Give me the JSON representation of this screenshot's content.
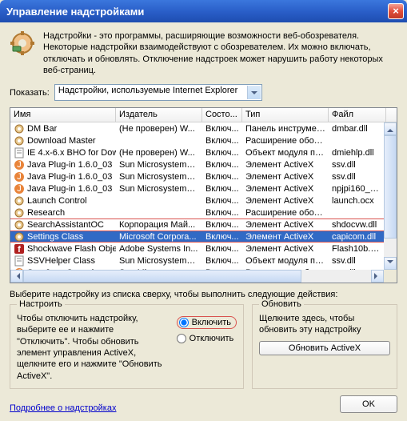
{
  "window_title": "Управление надстройками",
  "info": "Надстройки - это программы, расширяющие возможности веб-обозревателя. Некоторые надстройки взаимодействуют с обозревателем. Их можно включать, отключать и обновлять. Отключение надстроек может нарушить работу некоторых веб-страниц.",
  "show_label": "Показать:",
  "show_value": "Надстройки, используемые Internet Explorer",
  "columns": {
    "name": "Имя",
    "publisher": "Издатель",
    "state": "Состо...",
    "type": "Тип",
    "file": "Файл"
  },
  "rows": [
    {
      "icon": "gear-small",
      "name": "DM Bar",
      "publisher": "(Не проверен) W...",
      "state": "Включ...",
      "type": "Панель инструмен...",
      "file": "dmbar.dll"
    },
    {
      "icon": "gear-small",
      "name": "Download Master",
      "publisher": "",
      "state": "Включ...",
      "type": "Расширение обозр...",
      "file": ""
    },
    {
      "icon": "doc",
      "name": "IE 4.x-6.x BHO for Dow...",
      "publisher": "(Не проверен) W...",
      "state": "Включ...",
      "type": "Объект модуля по...",
      "file": "dmiehlp.dll"
    },
    {
      "icon": "java",
      "name": "Java Plug-in 1.6.0_03",
      "publisher": "Sun Microsystems,...",
      "state": "Включ...",
      "type": "Элемент ActiveX",
      "file": "ssv.dll"
    },
    {
      "icon": "java",
      "name": "Java Plug-in 1.6.0_03",
      "publisher": "Sun Microsystems,...",
      "state": "Включ...",
      "type": "Элемент ActiveX",
      "file": "ssv.dll"
    },
    {
      "icon": "java",
      "name": "Java Plug-in 1.6.0_03",
      "publisher": "Sun Microsystems,...",
      "state": "Включ...",
      "type": "Элемент ActiveX",
      "file": "npjpi160_03.dll"
    },
    {
      "icon": "gear-small",
      "name": "Launch Control",
      "publisher": "",
      "state": "Включ...",
      "type": "Элемент ActiveX",
      "file": "launch.ocx"
    },
    {
      "icon": "gear-small",
      "name": "Research",
      "publisher": "",
      "state": "Включ...",
      "type": "Расширение обозр...",
      "file": ""
    },
    {
      "icon": "gear-small",
      "name": "SearchAssistantOC",
      "publisher": "Корпорация Май...",
      "state": "Включ...",
      "type": "Элемент ActiveX",
      "file": "shdocvw.dll",
      "hl_top": true
    },
    {
      "icon": "gear-small",
      "name": "Settings Class",
      "publisher": "Microsoft Corpora...",
      "state": "Включ...",
      "type": "Элемент ActiveX",
      "file": "capicom.dll",
      "selected": true,
      "hl_bot": true
    },
    {
      "icon": "flash",
      "name": "Shockwave Flash Object",
      "publisher": "Adobe Systems In...",
      "state": "Включ...",
      "type": "Элемент ActiveX",
      "file": "Flash10b.ocx"
    },
    {
      "icon": "doc",
      "name": "SSVHelper Class",
      "publisher": "Sun Microsystems,...",
      "state": "Включ...",
      "type": "Объект модуля по...",
      "file": "ssv.dll"
    },
    {
      "icon": "java",
      "name": "Sun Java Console",
      "publisher": "Sun Microsystems,...",
      "state": "Включ...",
      "type": "Расширение обозр...",
      "file": "ssv.dll"
    }
  ],
  "instruction": "Выберите надстройку из списка сверху, чтобы выполнить следующие действия:",
  "group_settings_title": "Настроить",
  "settings_text": "Чтобы отключить надстройку, выберите ее и нажмите \"Отключить\". Чтобы обновить элемент управления ActiveX, щелкните его и нажмите \"Обновить ActiveX\".",
  "radio_enable": "Включить",
  "radio_disable": "Отключить",
  "group_update_title": "Обновить",
  "update_text": "Щелкните здесь, чтобы обновить эту надстройку",
  "update_btn": "Обновить ActiveX",
  "more_link": "Подробнее о надстройках",
  "ok": "OK"
}
